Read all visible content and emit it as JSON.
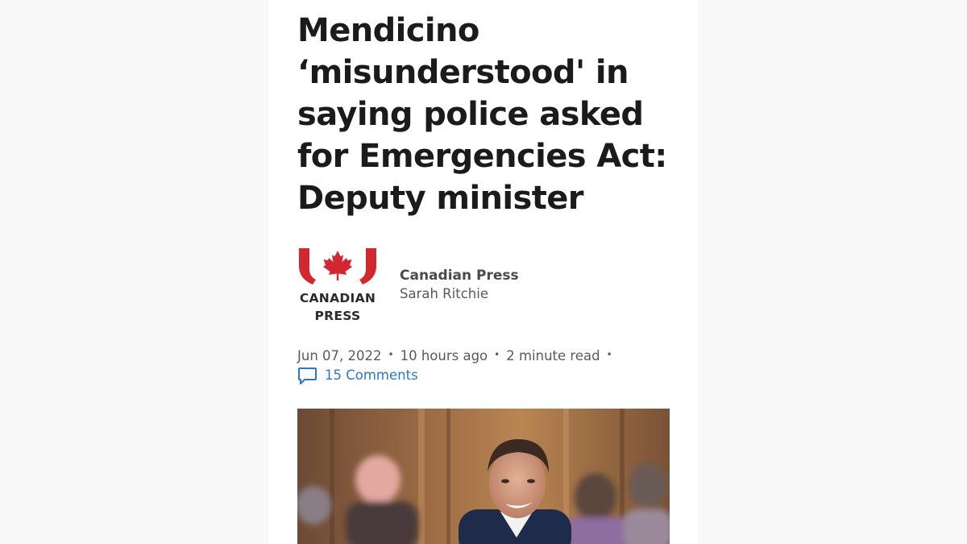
{
  "article": {
    "headline": "Mendicino ‘misunderstood' in saying police asked for Emergencies Act: Deputy minister",
    "logo": {
      "line1": "CANADIAN",
      "line2": "PRESS",
      "color": "#d2272e"
    },
    "source": "Canadian Press",
    "author": "Sarah Ritchie",
    "date": "Jun 07, 2022",
    "relative_time": "10 hours ago",
    "read_time": "2 minute read",
    "separator": "•",
    "comments_label": "15 Comments",
    "comments_icon": "speech-bubble-icon",
    "link_color": "#2d77c8"
  }
}
